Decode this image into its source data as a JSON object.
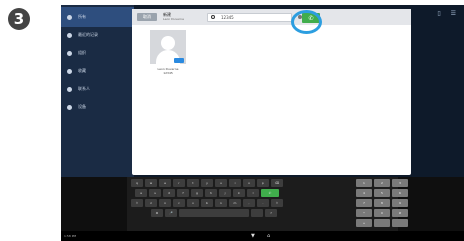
{
  "step_number": "3",
  "sidebar": {
    "items": [
      {
        "label": "所有"
      },
      {
        "label": "最近的记录"
      },
      {
        "label": "组织"
      },
      {
        "label": "收藏"
      },
      {
        "label": "联系人"
      },
      {
        "label": "设备"
      }
    ]
  },
  "right_icons": "▯ ☰",
  "dialog": {
    "cancel_label": "取消",
    "title": "新建",
    "subtitle": "Leon Duverne",
    "search_value": "12345",
    "call_icon_glyph": "✆",
    "contact": {
      "name": "Leon Duverne",
      "number": "12345"
    }
  },
  "keyboard": {
    "row1": [
      "q",
      "w",
      "e",
      "r",
      "t",
      "y",
      "u",
      "i",
      "o",
      "p",
      "⌫"
    ],
    "row2": [
      "a",
      "s",
      "d",
      "f",
      "g",
      "h",
      "j",
      "k",
      "l",
      "✆"
    ],
    "row3": [
      "⇧",
      "z",
      "x",
      "c",
      "v",
      "b",
      "n",
      "m",
      ",",
      ".",
      "⇧"
    ],
    "row4": [
      "⚙",
      "🎤",
      "",
      "",
      "?"
    ],
    "numpad": [
      [
        "1",
        "2",
        "3"
      ],
      [
        "4",
        "5",
        "6"
      ],
      [
        "7",
        "8",
        "9"
      ],
      [
        "*",
        "0",
        "#"
      ],
      [
        "+",
        "",
        ""
      ]
    ]
  },
  "navbar": {
    "status_left": "1:58 PM",
    "back_icon": "▼",
    "home_icon": "⌂"
  }
}
